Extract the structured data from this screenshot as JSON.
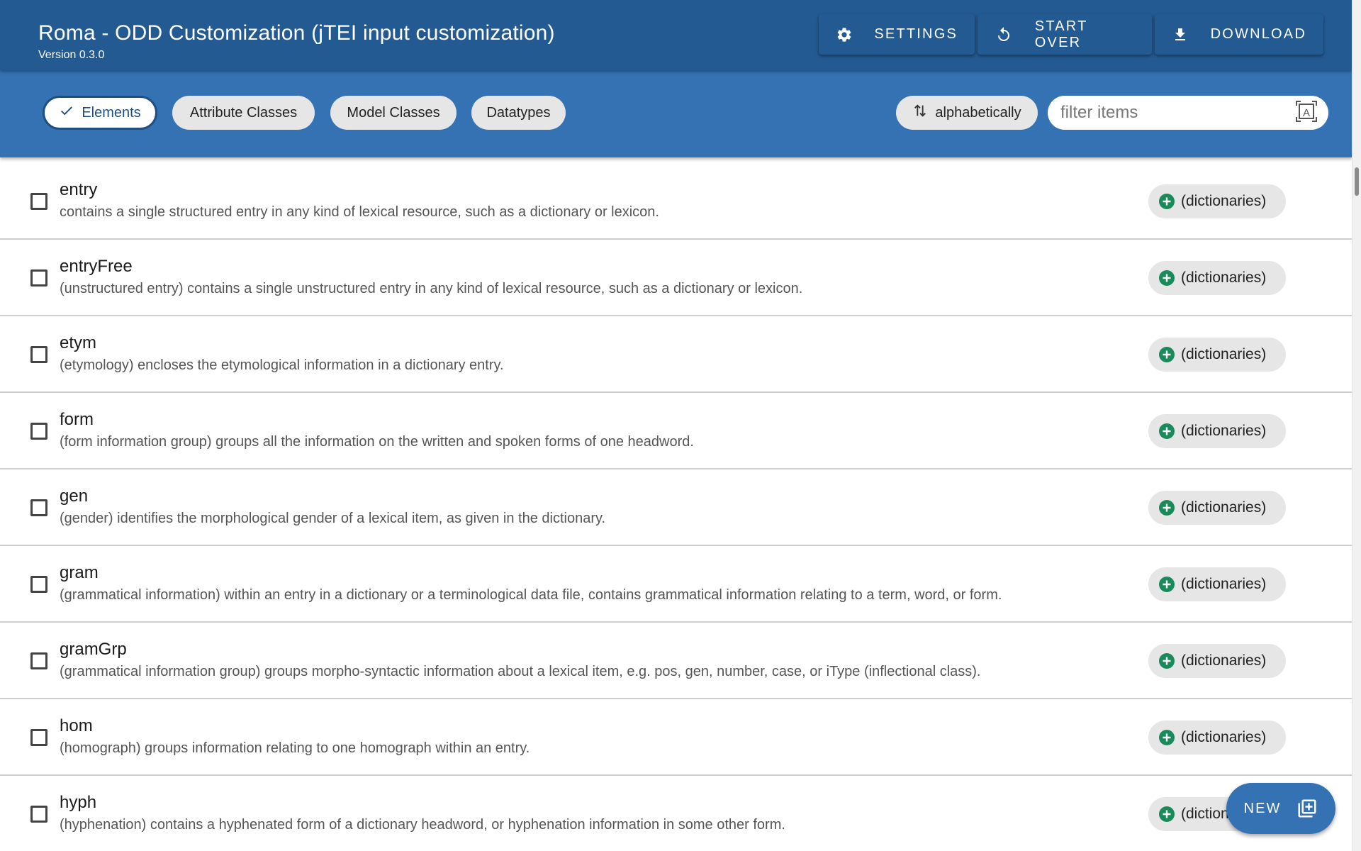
{
  "app": {
    "title": "Roma - ODD Customization (jTEI input customization)",
    "version": "Version 0.3.0"
  },
  "actions": {
    "settings": "SETTINGS",
    "start_over": "START OVER",
    "download": "DOWNLOAD"
  },
  "tabs": [
    {
      "label": "Elements",
      "selected": true
    },
    {
      "label": "Attribute Classes",
      "selected": false
    },
    {
      "label": "Model Classes",
      "selected": false
    },
    {
      "label": "Datatypes",
      "selected": false
    }
  ],
  "sort": {
    "label": "alphabetically"
  },
  "filter": {
    "placeholder": "filter items",
    "value": ""
  },
  "items": [
    {
      "name": "entry",
      "desc": "contains a single structured entry in any kind of lexical resource, such as a dictionary or lexicon.",
      "module": "(dictionaries)",
      "checked": false
    },
    {
      "name": "entryFree",
      "desc": "(unstructured entry) contains a single unstructured entry in any kind of lexical resource, such as a dictionary or lexicon.",
      "module": "(dictionaries)",
      "checked": false
    },
    {
      "name": "etym",
      "desc": "(etymology) encloses the etymological information in a dictionary entry.",
      "module": "(dictionaries)",
      "checked": false
    },
    {
      "name": "form",
      "desc": "(form information group) groups all the information on the written and spoken forms of one headword.",
      "module": "(dictionaries)",
      "checked": false
    },
    {
      "name": "gen",
      "desc": "(gender) identifies the morphological gender of a lexical item, as given in the dictionary.",
      "module": "(dictionaries)",
      "checked": false
    },
    {
      "name": "gram",
      "desc": "(grammatical information) within an entry in a dictionary or a terminological data file, contains grammatical information relating to a term, word, or form.",
      "module": "(dictionaries)",
      "checked": false
    },
    {
      "name": "gramGrp",
      "desc": "(grammatical information group) groups morpho-syntactic information about a lexical item, e.g. pos, gen, number, case, or iType (inflectional class).",
      "module": "(dictionaries)",
      "checked": false
    },
    {
      "name": "hom",
      "desc": "(homograph) groups information relating to one homograph within an entry.",
      "module": "(dictionaries)",
      "checked": false
    },
    {
      "name": "hyph",
      "desc": "(hyphenation) contains a hyphenated form of a dictionary headword, or hyphenation information in some other form.",
      "module": "(dictionaries)",
      "checked": false
    }
  ],
  "fab": {
    "label": "NEW"
  },
  "colors": {
    "appbar": "#245a92",
    "toolbar": "#3472b4",
    "chip": "#e6e6e6",
    "add_icon": "#1b8a5a"
  }
}
